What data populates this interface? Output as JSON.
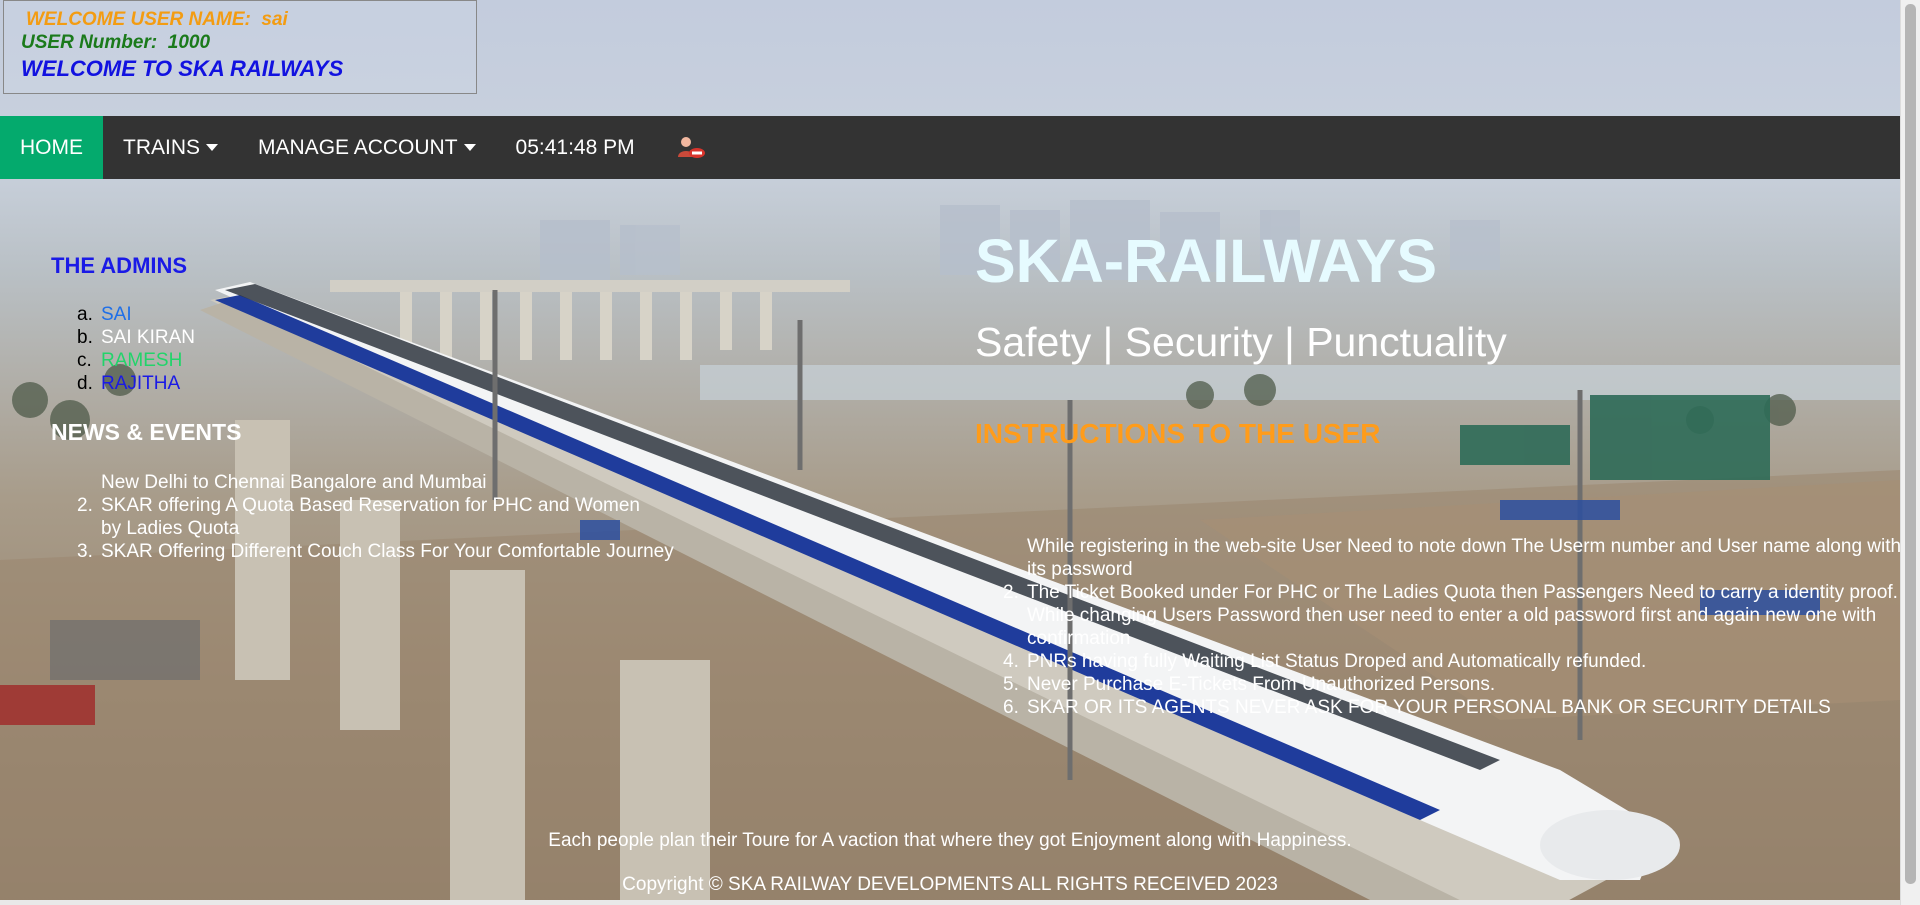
{
  "welcome": {
    "user_name_label": "WELCOME USER NAME:",
    "user_name": "sai",
    "user_number_label": "USER Number:",
    "user_number": "1000",
    "welcome_line": "WELCOME TO SKA RAILWAYS"
  },
  "navbar": {
    "home": "HOME",
    "trains": "TRAINS",
    "manage_account": "MANAGE ACCOUNT",
    "clock": "05:41:48 PM",
    "logout_icon": "logout-icon"
  },
  "admins": {
    "title": "THE ADMINS",
    "items": [
      {
        "marker": "a.",
        "name": "SAI",
        "color": "#1e6fe8"
      },
      {
        "marker": "b.",
        "name": "SAI KIRAN",
        "color": "#ffffff"
      },
      {
        "marker": "c.",
        "name": "RAMESH",
        "color": "#21d46a"
      },
      {
        "marker": "d.",
        "name": "RAJITHA",
        "color": "#1a1ae6"
      }
    ]
  },
  "news": {
    "title": "NEWS & EVENTS",
    "items": [
      {
        "marker": "",
        "text": "New Delhi to Chennai Bangalore and Mumbai"
      },
      {
        "marker": "2.",
        "text": "SKAR offering A Quota Based Reservation for PHC and Women by Ladies Quota"
      },
      {
        "marker": "3.",
        "text": "SKAR Offering Different Couch Class For Your Comfortable Journey"
      }
    ]
  },
  "hero": {
    "title": "SKA-RAILWAYS",
    "tagline": "Safety | Security | Punctuality"
  },
  "instructions": {
    "title": "INSTRUCTIONS TO THE USER",
    "items": [
      {
        "marker": "",
        "text": "While registering in the web-site User Need to note down The Userm number and User name along with its password"
      },
      {
        "marker": "2.",
        "text": "The Ticket Booked under For PHC or The Ladies Quota then Passengers Need to carry a identity proof."
      },
      {
        "marker": "",
        "text": "While changing Users Password then user need to enter a old password first and again new one with confirmation"
      },
      {
        "marker": "4.",
        "text": "PNRs having fully Waiting List Status Droped and Automatically refunded."
      },
      {
        "marker": "5.",
        "text": "Never Purchase E-Tickets From Unauthorized Persons."
      },
      {
        "marker": "6.",
        "text": "SKAR OR ITS AGENTS NEVER ASK FOR YOUR PERSONAL BANK OR SECURITY DETAILS"
      }
    ]
  },
  "footer": {
    "note": "Each people plan their Toure for A vaction that where they got Enjoyment along with Happiness.",
    "copyright": "Copyright © SKA RAILWAY DEVELOPMENTS ALL RIGHTS RECEIVED 2023"
  },
  "colors": {
    "navbar_bg": "#333333",
    "home_active": "#04aa6d",
    "accent_orange": "#ff9c1a",
    "welcome_blue": "#1212e0"
  }
}
